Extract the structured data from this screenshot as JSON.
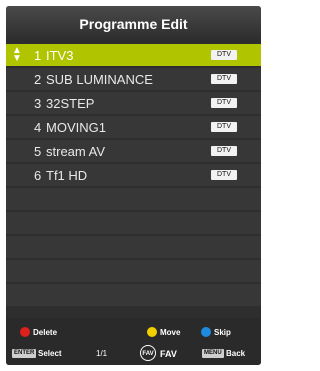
{
  "header": {
    "title": "Programme Edit"
  },
  "channels": [
    {
      "number": "1",
      "name": "ITV3",
      "badge": "DTV",
      "selected": true
    },
    {
      "number": "2",
      "name": "SUB LUMINANCE",
      "badge": "DTV",
      "selected": false
    },
    {
      "number": "3",
      "name": "32STEP",
      "badge": "DTV",
      "selected": false
    },
    {
      "number": "4",
      "name": "MOVING1",
      "badge": "DTV",
      "selected": false
    },
    {
      "number": "5",
      "name": "stream AV",
      "badge": "DTV",
      "selected": false
    },
    {
      "number": "6",
      "name": "Tf1 HD",
      "badge": "DTV",
      "selected": false
    }
  ],
  "footer": {
    "delete_label": "Delete",
    "move_label": "Move",
    "skip_label": "Skip",
    "select_key": "ENTER",
    "select_label": "Select",
    "page": "1/1",
    "fav_icon_text": "FAV",
    "fav_label": "FAV",
    "back_key": "MENU",
    "back_label": "Back"
  },
  "colors": {
    "selected_row": "#b0c400",
    "delete_button": "#e0201c",
    "move_button": "#f2d000",
    "skip_button": "#1f8be0"
  }
}
